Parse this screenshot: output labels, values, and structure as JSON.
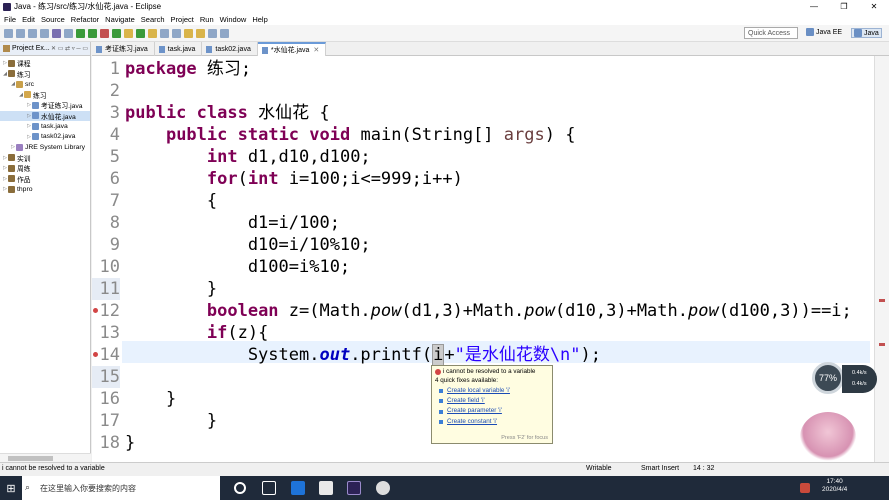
{
  "window": {
    "title": "Java - 练习/src/练习/水仙花.java - Eclipse",
    "min": "—",
    "max": "❐",
    "close": "✕"
  },
  "menu": [
    "File",
    "Edit",
    "Source",
    "Refactor",
    "Navigate",
    "Search",
    "Project",
    "Run",
    "Window",
    "Help"
  ],
  "quick_access": {
    "placeholder": "Quick Access"
  },
  "perspectives": [
    {
      "label": "Java EE"
    },
    {
      "label": "Java"
    }
  ],
  "explorer": {
    "tab": "Project Ex...",
    "items": [
      {
        "label": "课程",
        "level": 0,
        "icon": "project-icon"
      },
      {
        "label": "练习",
        "level": 0,
        "icon": "project-icon"
      },
      {
        "label": "src",
        "level": 1,
        "icon": "source-folder-icon"
      },
      {
        "label": "练习",
        "level": 2,
        "icon": "package-icon"
      },
      {
        "label": "考证练习.java",
        "level": 3,
        "icon": "java-file-icon"
      },
      {
        "label": "水仙花.java",
        "level": 3,
        "icon": "java-file-icon",
        "selected": true
      },
      {
        "label": "task.java",
        "level": 3,
        "icon": "java-file-icon"
      },
      {
        "label": "task02.java",
        "level": 3,
        "icon": "java-file-icon"
      },
      {
        "label": "JRE System Library",
        "level": 1,
        "icon": "library-icon"
      },
      {
        "label": "实训",
        "level": 0,
        "icon": "project-icon"
      },
      {
        "label": "周练",
        "level": 0,
        "icon": "project-icon"
      },
      {
        "label": "作品",
        "level": 0,
        "icon": "project-icon"
      },
      {
        "label": "thpro",
        "level": 0,
        "icon": "project-icon"
      }
    ]
  },
  "editor_tabs": [
    {
      "label": "考证练习.java"
    },
    {
      "label": "task.java"
    },
    {
      "label": "task02.java"
    },
    {
      "label": "*水仙花.java",
      "active": true
    }
  ],
  "code_lines": [
    "1",
    "2",
    "3",
    "4",
    "5",
    "6",
    "7",
    "8",
    "9",
    "10",
    "11",
    "12",
    "13",
    "14",
    "15",
    "16",
    "17",
    "18"
  ],
  "code": {
    "l1a": "package",
    "l1b": " 练习;",
    "l3a": "public",
    "l3b": " ",
    "l3c": "class",
    "l3d": " 水仙花 {",
    "l4a": "    ",
    "l4b": "public",
    "l4c": " ",
    "l4d": "static",
    "l4e": " ",
    "l4f": "void",
    "l4g": " main(String[] ",
    "l4h": "args",
    "l4i": ") {",
    "l5a": "        ",
    "l5b": "int",
    "l5c": " d1,d10,d100;",
    "l6a": "        ",
    "l6b": "for",
    "l6c": "(",
    "l6d": "int",
    "l6e": " i=100;i<=999;i++)",
    "l7": "        {",
    "l8": "            d1=i/100;",
    "l9": "            d10=i/10%10;",
    "l10": "            d100=i%10;",
    "l11": "        }",
    "l12a": "        ",
    "l12b": "boolean",
    "l12c": " z=(Math.",
    "l12d": "pow",
    "l12e": "(d1,3)+Math.",
    "l12f": "pow",
    "l12g": "(d10,3)+Math.",
    "l12h": "pow",
    "l12i": "(d100,3))==i;",
    "l13a": "        ",
    "l13b": "if",
    "l13c": "(z){",
    "l14a": "            System.",
    "l14b": "out",
    "l14c": ".printf(",
    "l14d": "i",
    "l14e": "+",
    "l14f": "\"是水仙花数\\n\"",
    "l14g": ");",
    "l16": "    }",
    "l17": "        }",
    "l18": "}"
  },
  "quickfix": {
    "title": "i cannot be resolved to a variable",
    "subtitle": "4 quick fixes available:",
    "fixes": [
      "Create local variable 'i'",
      "Create field 'i'",
      "Create parameter 'i'",
      "Create constant 'i'"
    ],
    "footer": "Press 'F2' for focus"
  },
  "status": {
    "message": "i cannot be resolved to a variable",
    "writable": "Writable",
    "insert": "Smart Insert",
    "position": "14 : 32"
  },
  "taskbar": {
    "search_placeholder": "在这里输入你要搜索的内容",
    "time": "17:40",
    "date": "2020/4/4"
  },
  "gauge": {
    "percent": "77%",
    "up": "0.4k/s",
    "down": "0.4k/s"
  }
}
